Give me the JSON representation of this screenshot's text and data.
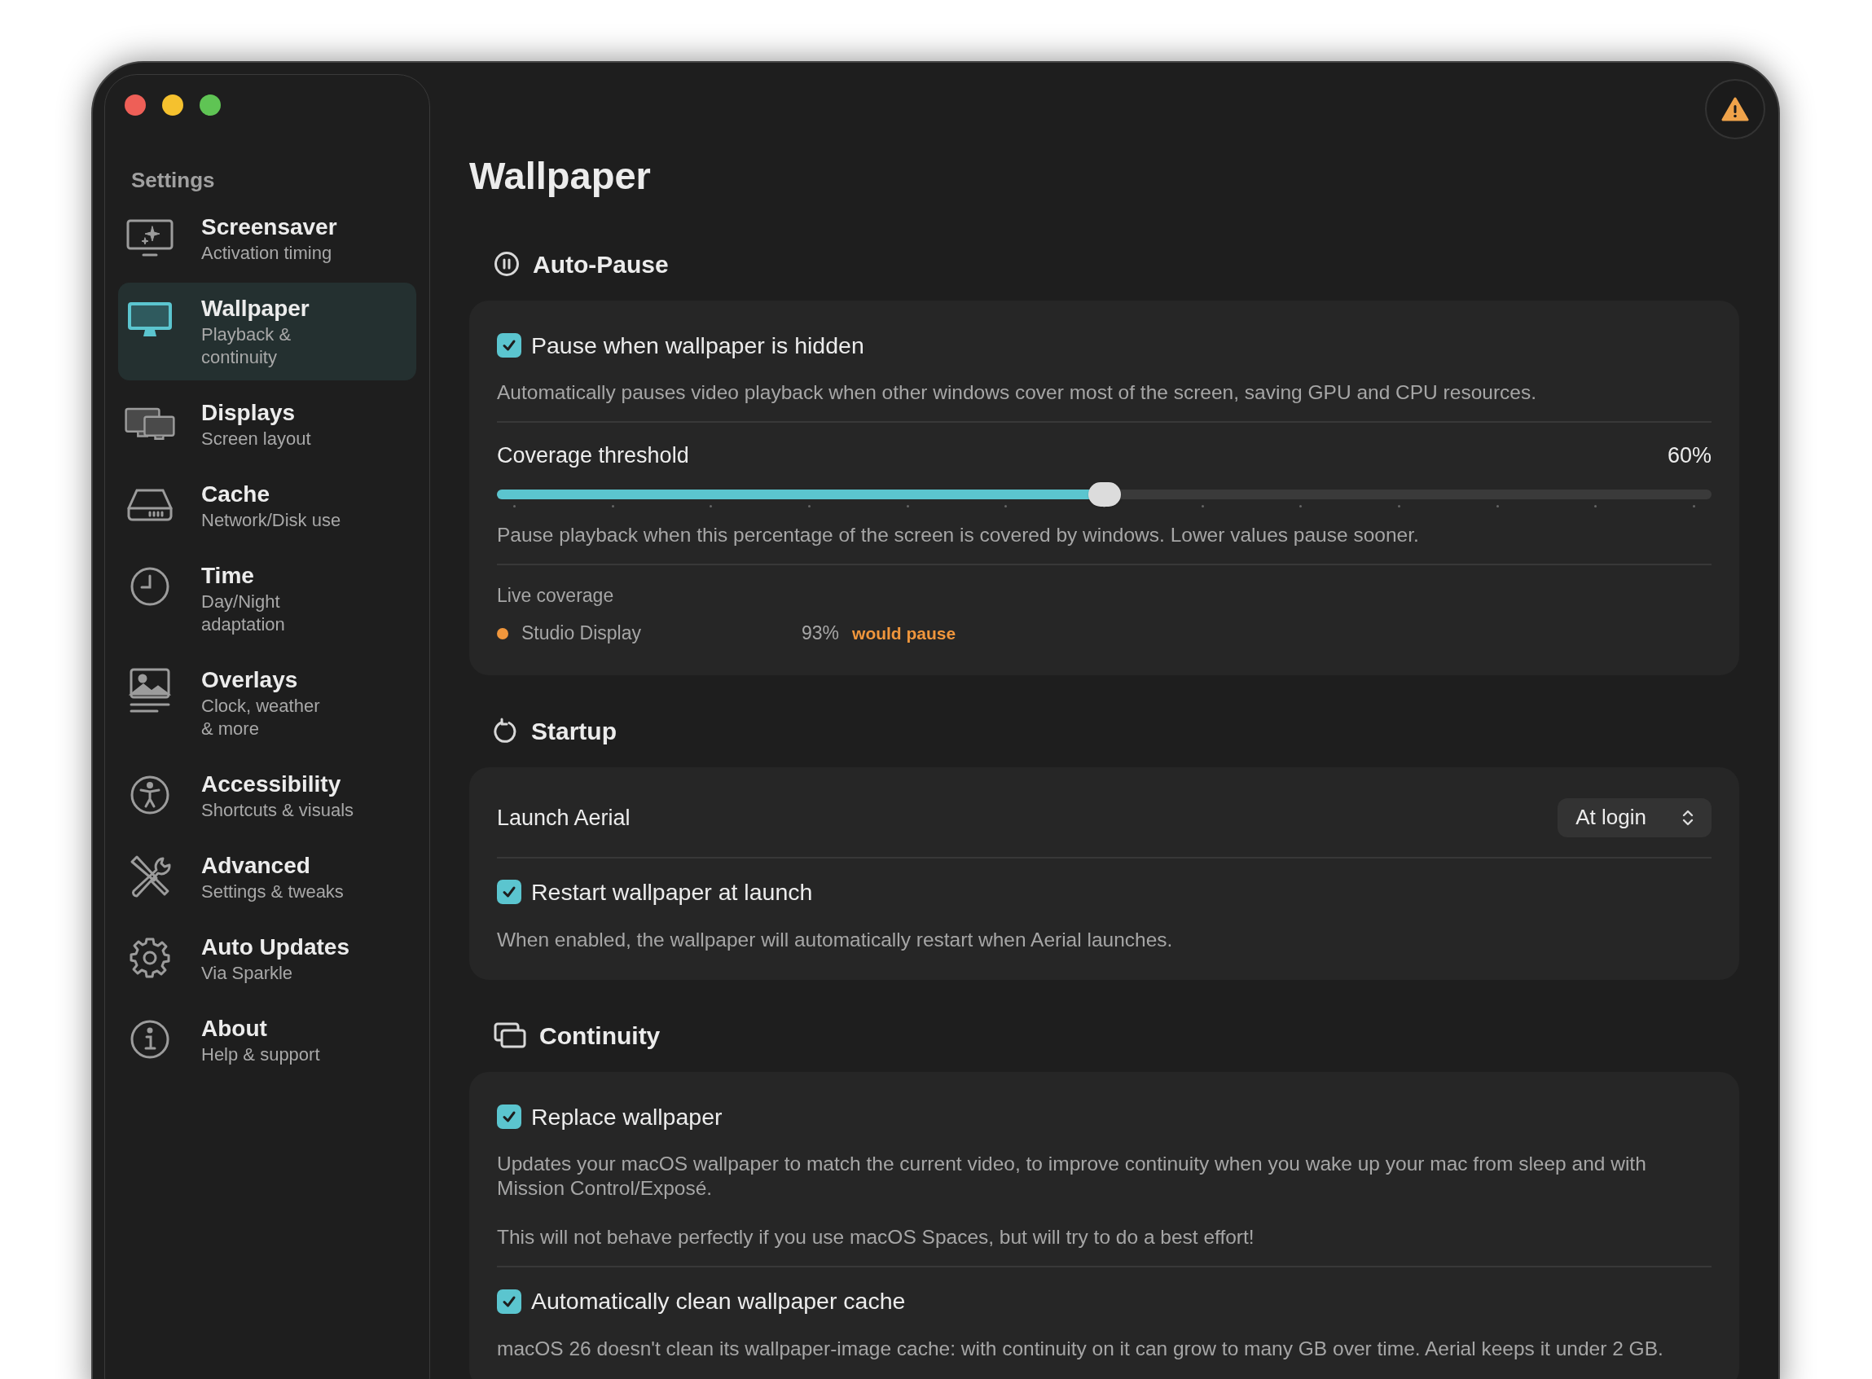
{
  "sidebar": {
    "title": "Settings",
    "items": [
      {
        "title": "Screensaver",
        "subtitle": "Activation timing",
        "selected": false
      },
      {
        "title": "Wallpaper",
        "subtitle": "Playback & continuity",
        "selected": true
      },
      {
        "title": "Displays",
        "subtitle": "Screen layout",
        "selected": false
      },
      {
        "title": "Cache",
        "subtitle": "Network/Disk use",
        "selected": false
      },
      {
        "title": "Time",
        "subtitle": "Day/Night adaptation",
        "selected": false
      },
      {
        "title": "Overlays",
        "subtitle": "Clock, weather & more",
        "selected": false
      },
      {
        "title": "Accessibility",
        "subtitle": "Shortcuts & visuals",
        "selected": false
      },
      {
        "title": "Advanced",
        "subtitle": "Settings & tweaks",
        "selected": false
      },
      {
        "title": "Auto Updates",
        "subtitle": "Via Sparkle",
        "selected": false
      },
      {
        "title": "About",
        "subtitle": "Help & support",
        "selected": false
      }
    ]
  },
  "page_title": "Wallpaper",
  "sections": [
    {
      "title": "Auto-Pause",
      "rows": [
        {
          "kind": "checkbox",
          "label": "Pause when wallpaper is hidden",
          "checked": true,
          "description": [
            "Automatically pauses video playback when other windows cover most of the screen, saving GPU and CPU resources."
          ]
        },
        {
          "kind": "slider",
          "label": "Coverage threshold",
          "reading": "60%",
          "level": 0.5,
          "description": [
            "Pause playback when this percentage of the screen is covered by windows. Lower values pause sooner."
          ]
        },
        {
          "kind": "live",
          "label": "Live coverage",
          "displays": [
            {
              "name": "Studio Display",
              "reading": "93%",
              "status": "would pause",
              "color": "#f0963c"
            }
          ]
        }
      ]
    },
    {
      "title": "Startup",
      "rows": [
        {
          "kind": "select",
          "label": "Launch Aerial",
          "value": "At login"
        },
        {
          "kind": "checkbox",
          "label": "Restart wallpaper at launch",
          "checked": true,
          "description": [
            "When enabled, the wallpaper will automatically restart when Aerial launches."
          ]
        }
      ]
    },
    {
      "title": "Continuity",
      "rows": [
        {
          "kind": "checkbox",
          "label": "Replace wallpaper",
          "checked": true,
          "description": [
            "Updates your macOS wallpaper to match the current video, to improve continuity when you wake up your mac from sleep and with Mission Control/Exposé.",
            "This will not behave perfectly if you use macOS Spaces, but will try to do a best effort!"
          ]
        },
        {
          "kind": "checkbox",
          "label": "Automatically clean wallpaper cache",
          "checked": true,
          "description": [
            "macOS 26 doesn't clean its wallpaper-image cache: with continuity on it can grow to many GB over time. Aerial keeps it under 2 GB."
          ]
        }
      ]
    }
  ]
}
